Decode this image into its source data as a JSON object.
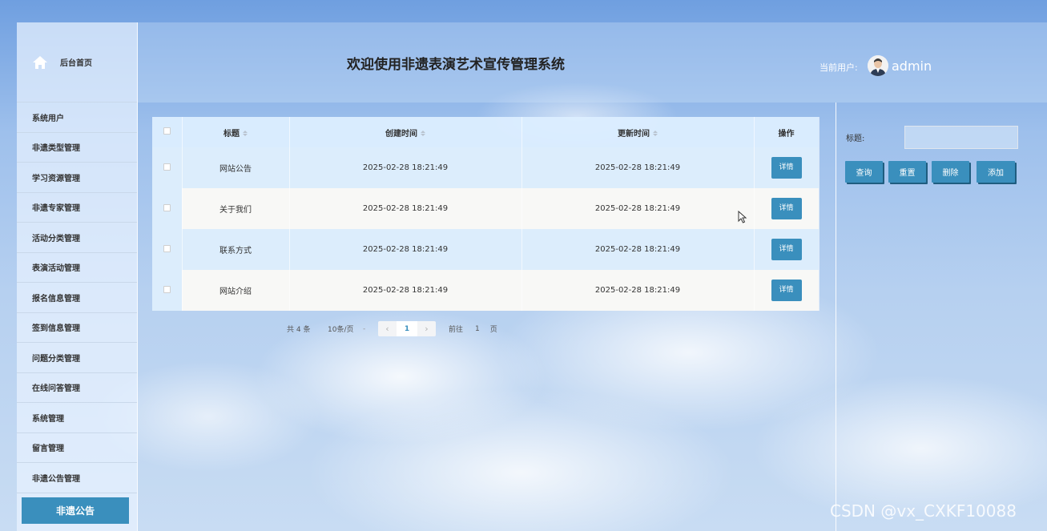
{
  "sidebar": {
    "home_label": "后台首页",
    "items": [
      {
        "label": "系统用户"
      },
      {
        "label": "非遗类型管理"
      },
      {
        "label": "学习资源管理"
      },
      {
        "label": "非遗专家管理"
      },
      {
        "label": "活动分类管理"
      },
      {
        "label": "表演活动管理"
      },
      {
        "label": "报名信息管理"
      },
      {
        "label": "签到信息管理"
      },
      {
        "label": "问题分类管理"
      },
      {
        "label": "在线问答管理"
      },
      {
        "label": "系统管理"
      },
      {
        "label": "留言管理"
      },
      {
        "label": "非遗公告管理"
      }
    ],
    "active_label": "非遗公告"
  },
  "header": {
    "title": "欢迎使用非遗表演艺术宣传管理系统",
    "user_label": "当前用户:",
    "user_name": "admin"
  },
  "table": {
    "columns": {
      "title": "标题",
      "created": "创建时间",
      "updated": "更新时间",
      "actions": "操作"
    },
    "rows": [
      {
        "title": "网站公告",
        "created": "2025-02-28 18:21:49",
        "updated": "2025-02-28 18:21:49",
        "action": "详情"
      },
      {
        "title": "关于我们",
        "created": "2025-02-28 18:21:49",
        "updated": "2025-02-28 18:21:49",
        "action": "详情"
      },
      {
        "title": "联系方式",
        "created": "2025-02-28 18:21:49",
        "updated": "2025-02-28 18:21:49",
        "action": "详情"
      },
      {
        "title": "网站介绍",
        "created": "2025-02-28 18:21:49",
        "updated": "2025-02-28 18:21:49",
        "action": "详情"
      }
    ]
  },
  "pagination": {
    "total": "共 4 条",
    "page_size": "10条/页",
    "separator": "-",
    "current_page": "1",
    "goto_label": "前往",
    "goto_value": "1",
    "goto_unit": "页"
  },
  "search": {
    "label": "标题:",
    "buttons": {
      "query": "查询",
      "reset": "重置",
      "delete": "删除",
      "add": "添加"
    }
  },
  "watermark": "CSDN @vx_CXKF10088",
  "colors": {
    "accent": "#3a8fbd",
    "sidebar_bg": "#e9f3ff"
  }
}
